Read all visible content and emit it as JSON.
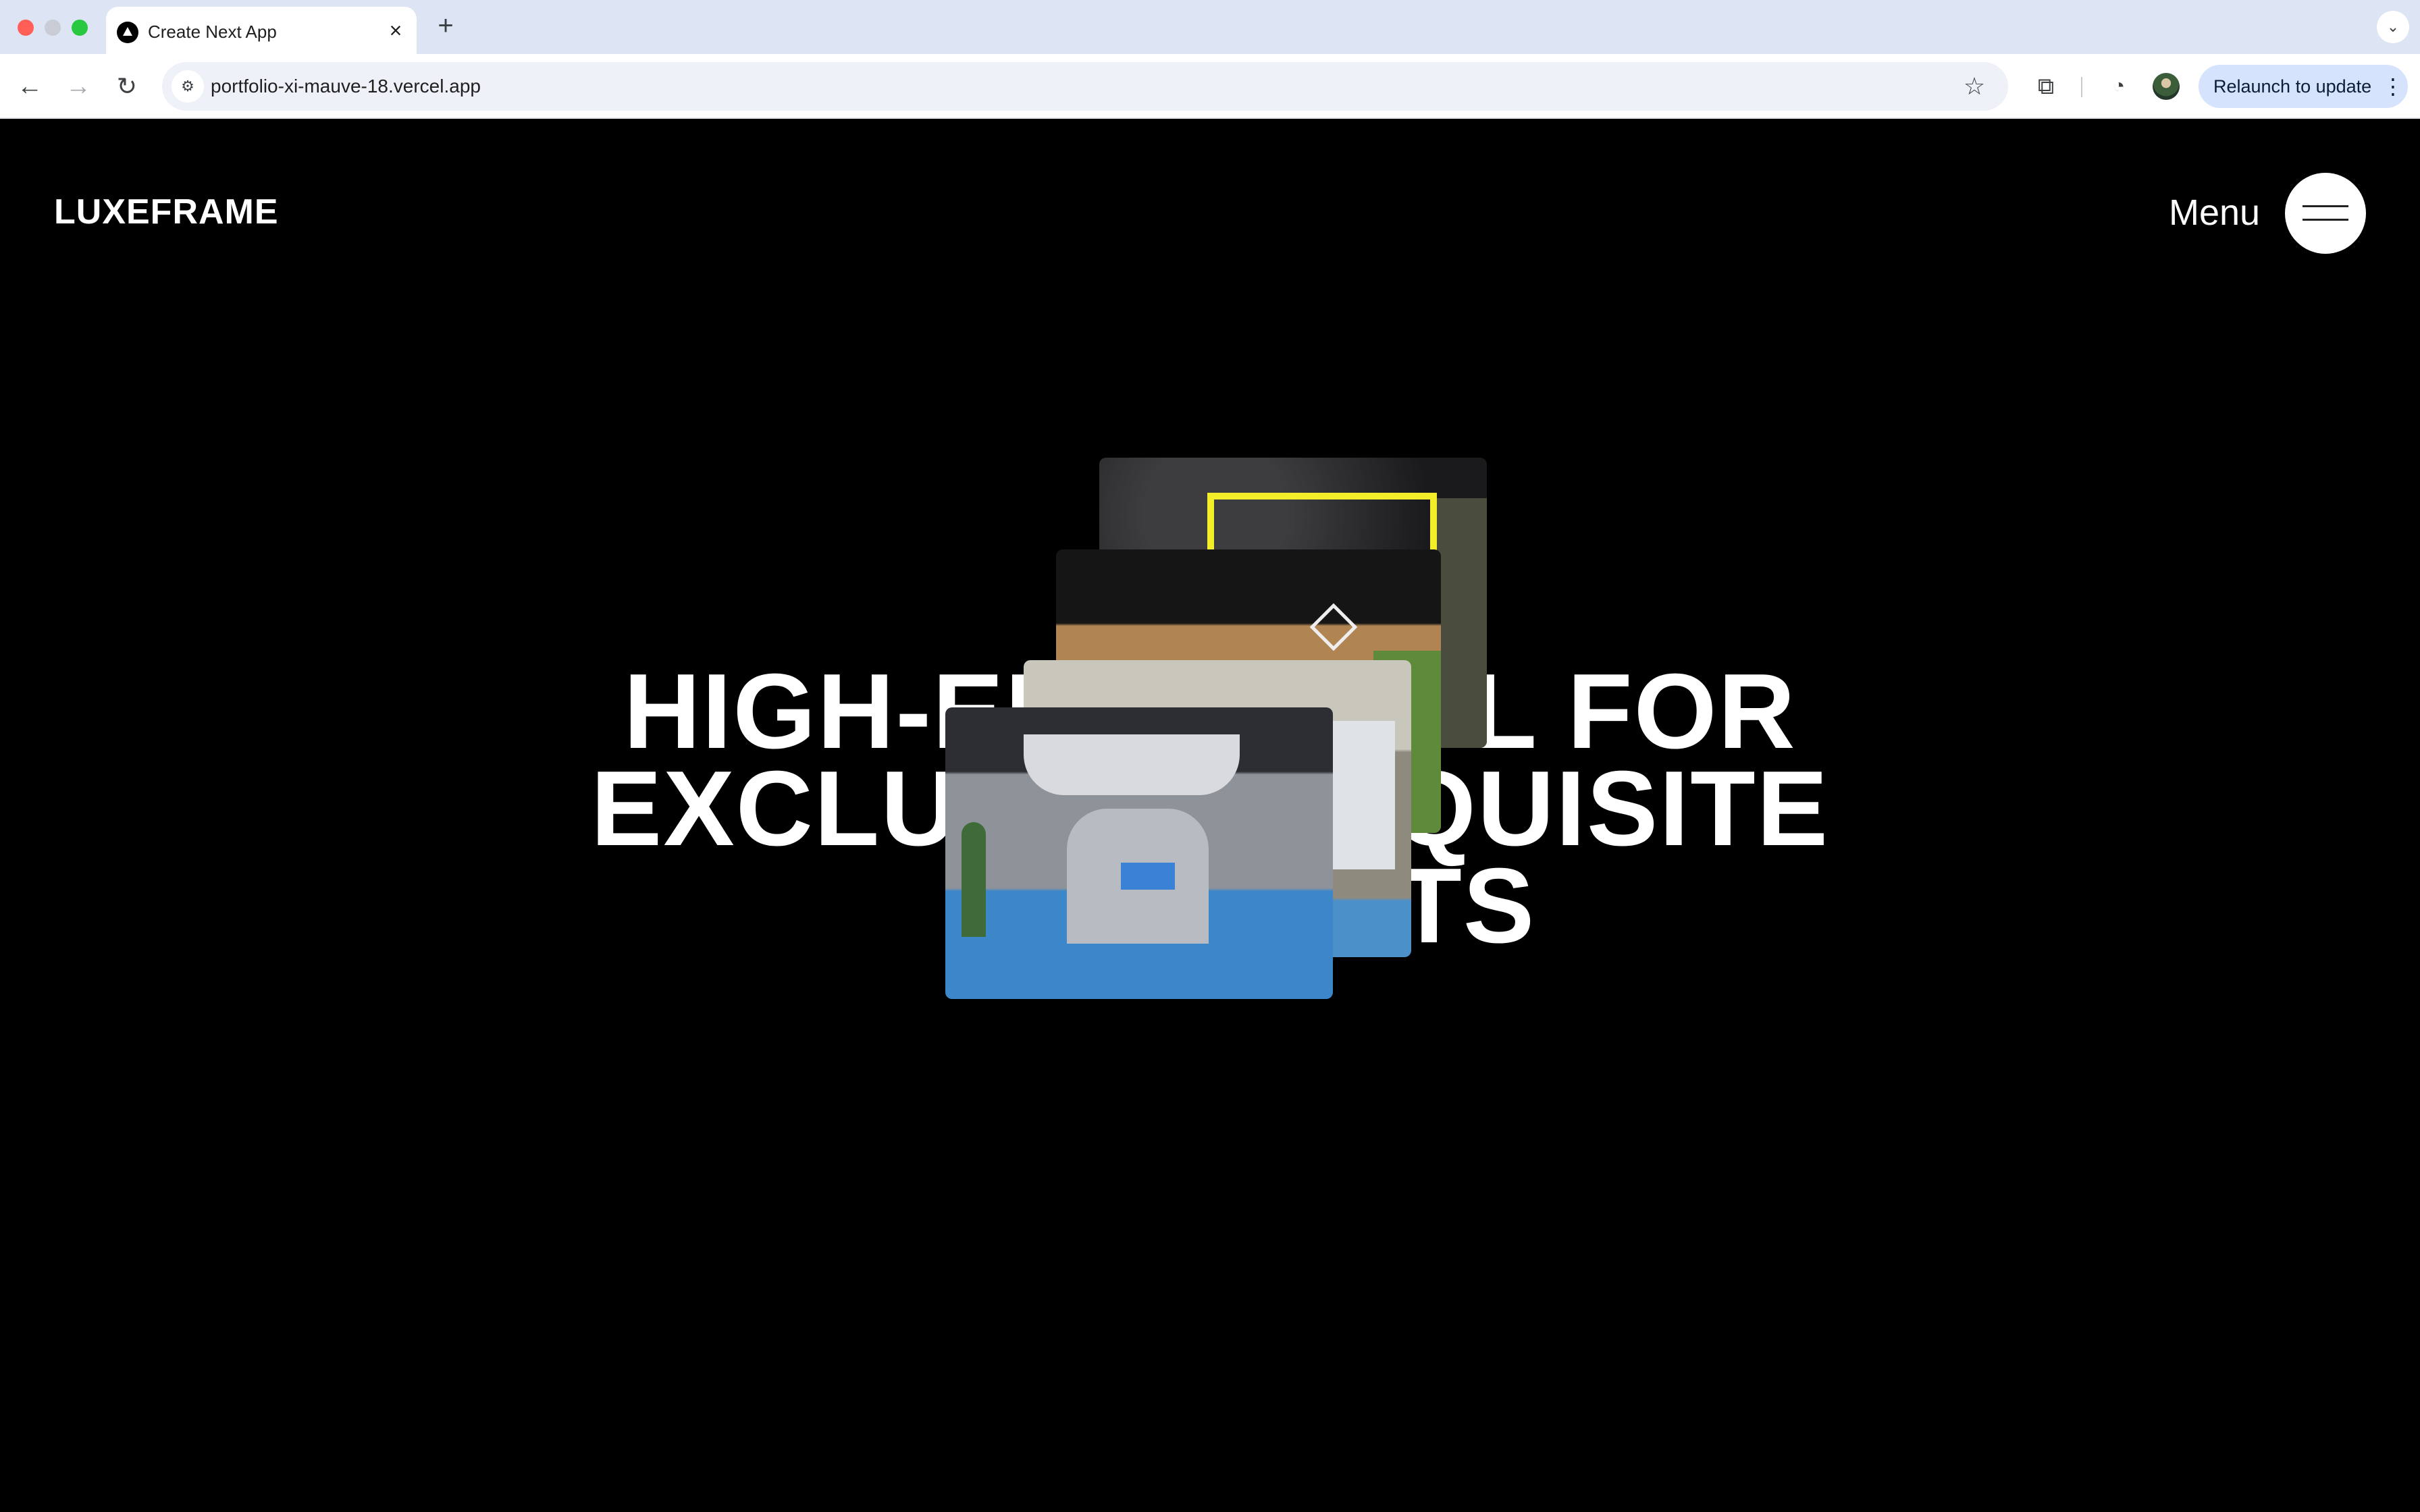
{
  "browser": {
    "tab": {
      "title": "Create Next App",
      "close_icon": "close-icon",
      "favicon": "nextjs-favicon-icon"
    },
    "new_tab_icon": "plus-icon",
    "tab_search_icon": "chevron-down-icon",
    "nav": {
      "back_icon": "arrow-left-icon",
      "forward_icon": "arrow-right-icon",
      "reload_icon": "reload-icon"
    },
    "omnibox": {
      "url": "portfolio-xi-mauve-18.vercel.app",
      "site_info_icon": "tune-icon",
      "bookmark_icon": "star-icon"
    },
    "extensions_icon": "puzzle-icon",
    "performance_icon": "speedometer-icon",
    "profile_icon": "avatar-icon",
    "relaunch": {
      "label": "Relaunch to update",
      "menu_icon": "kebab-menu-icon"
    },
    "colors": {
      "tabstrip": "#dde4f3",
      "relaunch_bg": "#d5e3fc"
    }
  },
  "page": {
    "logo": "LUXEFRAME",
    "menu_label": "Menu",
    "menu_icon": "hamburger-icon",
    "headline": {
      "line1": "HIGH-EN          AL FOR",
      "line2": "EXCLU              QUISITE",
      "line3": "              NTS"
    },
    "gallery": [
      "exhibition-booth-photo-1",
      "exhibition-booth-photo-2",
      "exhibition-booth-photo-3",
      "exhibition-booth-photo-4"
    ],
    "colors": {
      "background": "#000000",
      "text": "#ffffff",
      "accent": "#f2ee2a"
    }
  }
}
